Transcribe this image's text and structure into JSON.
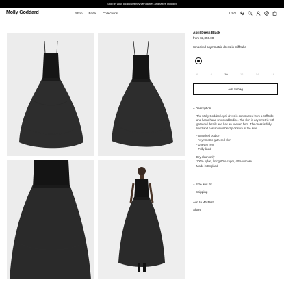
{
  "banner": {
    "text": "Shop in your local currency with duties and taxes included"
  },
  "header": {
    "logo": "Molly Goddard",
    "nav": [
      "Shop",
      "Bridal",
      "Collections"
    ],
    "currency": "US/$"
  },
  "product": {
    "title": "April Dress Black",
    "price": "from $3,850.00",
    "subtitle": "Smocked asymmetric dress in stiff tulle",
    "sizes": [
      "6",
      "8",
      "10",
      "12",
      "14",
      "16"
    ],
    "selected_size": "10",
    "add_to_bag": "Add to bag",
    "description_label": "Description",
    "description_marker": "–",
    "description_text": "The Molly Goddard April dress is constructed from a stiff tulle and has a hand-smocked bodice. The skirt is asymmetric with gathered details and has an uneven hem. The dress is fully lined and has an invisible zip closure at the side.",
    "features": [
      "- Smocked bodice",
      "- Asymmetric gathered skirt",
      "- Uneven hem",
      "- Fully lined"
    ],
    "care": [
      "Dry clean only",
      "100% nylon, lining 60% cupro, 40% viscose",
      "Made in England"
    ],
    "size_fit_label": "Size and Fit",
    "shipping_label": "Shipping",
    "accordion_marker": "+",
    "wishlist": "Add to Wishlist",
    "share": "Share"
  },
  "colors": {
    "banner": "#000000",
    "photo_bg": "#ececec",
    "dress": "#141414"
  }
}
